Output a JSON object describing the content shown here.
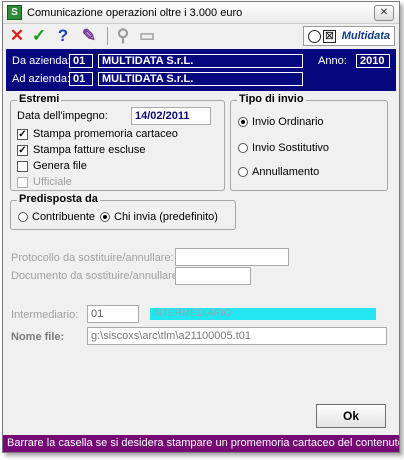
{
  "window": {
    "title": "Comunicazione operazioni oltre i 3.000 euro",
    "close_glyph": "✕"
  },
  "toolbar": {
    "items": [
      {
        "icon": "cancel-icon",
        "glyph": "✕",
        "color": "#e02020"
      },
      {
        "icon": "confirm-icon",
        "glyph": "✓",
        "color": "#1a9a1a"
      },
      {
        "icon": "help-icon",
        "glyph": "?",
        "color": "#1f3fb0"
      },
      {
        "icon": "edit-icon",
        "glyph": "✎",
        "color": "#7a3d9a"
      },
      {
        "icon": "binoculars-icon",
        "glyph": "⚲",
        "color": "#9a9a9a"
      },
      {
        "icon": "folder-icon",
        "glyph": "▭",
        "color": "#a8a8a8"
      }
    ],
    "logo_text": "Multidata",
    "logo_box_glyph": "⊠"
  },
  "header": {
    "from_label": "Da azienda:",
    "from_code": "01",
    "from_name": "MULTIDATA S.r.L.",
    "to_label": "Ad azienda:",
    "to_code": "01",
    "to_name": "MULTIDATA S.r.L.",
    "year_label": "Anno:",
    "year": "2010"
  },
  "estremi": {
    "title": "Estremi",
    "date_label": "Data dell'impegno:",
    "date_value": "14/02/2011",
    "checkboxes": [
      {
        "label": "Stampa promemoria cartaceo",
        "checked": true,
        "mark": "✓"
      },
      {
        "label": "Stampa fatture escluse",
        "checked": true,
        "mark": "✓"
      },
      {
        "label": "Genera file",
        "checked": false,
        "mark": ""
      },
      {
        "label": "Ufficiale",
        "checked": false,
        "mark": ""
      }
    ]
  },
  "tipo_invio": {
    "title": "Tipo di invio",
    "options": [
      "Invio Ordinario",
      "Invio Sostitutivo",
      "Annullamento"
    ],
    "selected": "Invio Ordinario"
  },
  "predisposta": {
    "title": "Predisposta da",
    "options": [
      "Contribuente",
      "Chi invia (predefinito)"
    ],
    "selected": "Chi invia (predefinito)"
  },
  "protocol": {
    "label": "Protocollo da sostituire/annullare:",
    "value": ""
  },
  "document": {
    "label": "Documento da sostituire/annullare:",
    "value": ""
  },
  "intermediary": {
    "label": "Intermediario:",
    "code": "01",
    "name": "INTERMEDIARIO"
  },
  "filename": {
    "label": "Nome file:",
    "value": "g:\\siscoxs\\arc\\tlm\\a21100005.t01"
  },
  "ok_button": {
    "label": "Ok"
  },
  "status_bar": {
    "text": "Barrare la casella se si desidera stampare un promemoria cartaceo del contenuto",
    "color": "#750a75"
  },
  "colors": {
    "header_bg": "#08087e",
    "intermediary_bg": "#24e6f2"
  }
}
